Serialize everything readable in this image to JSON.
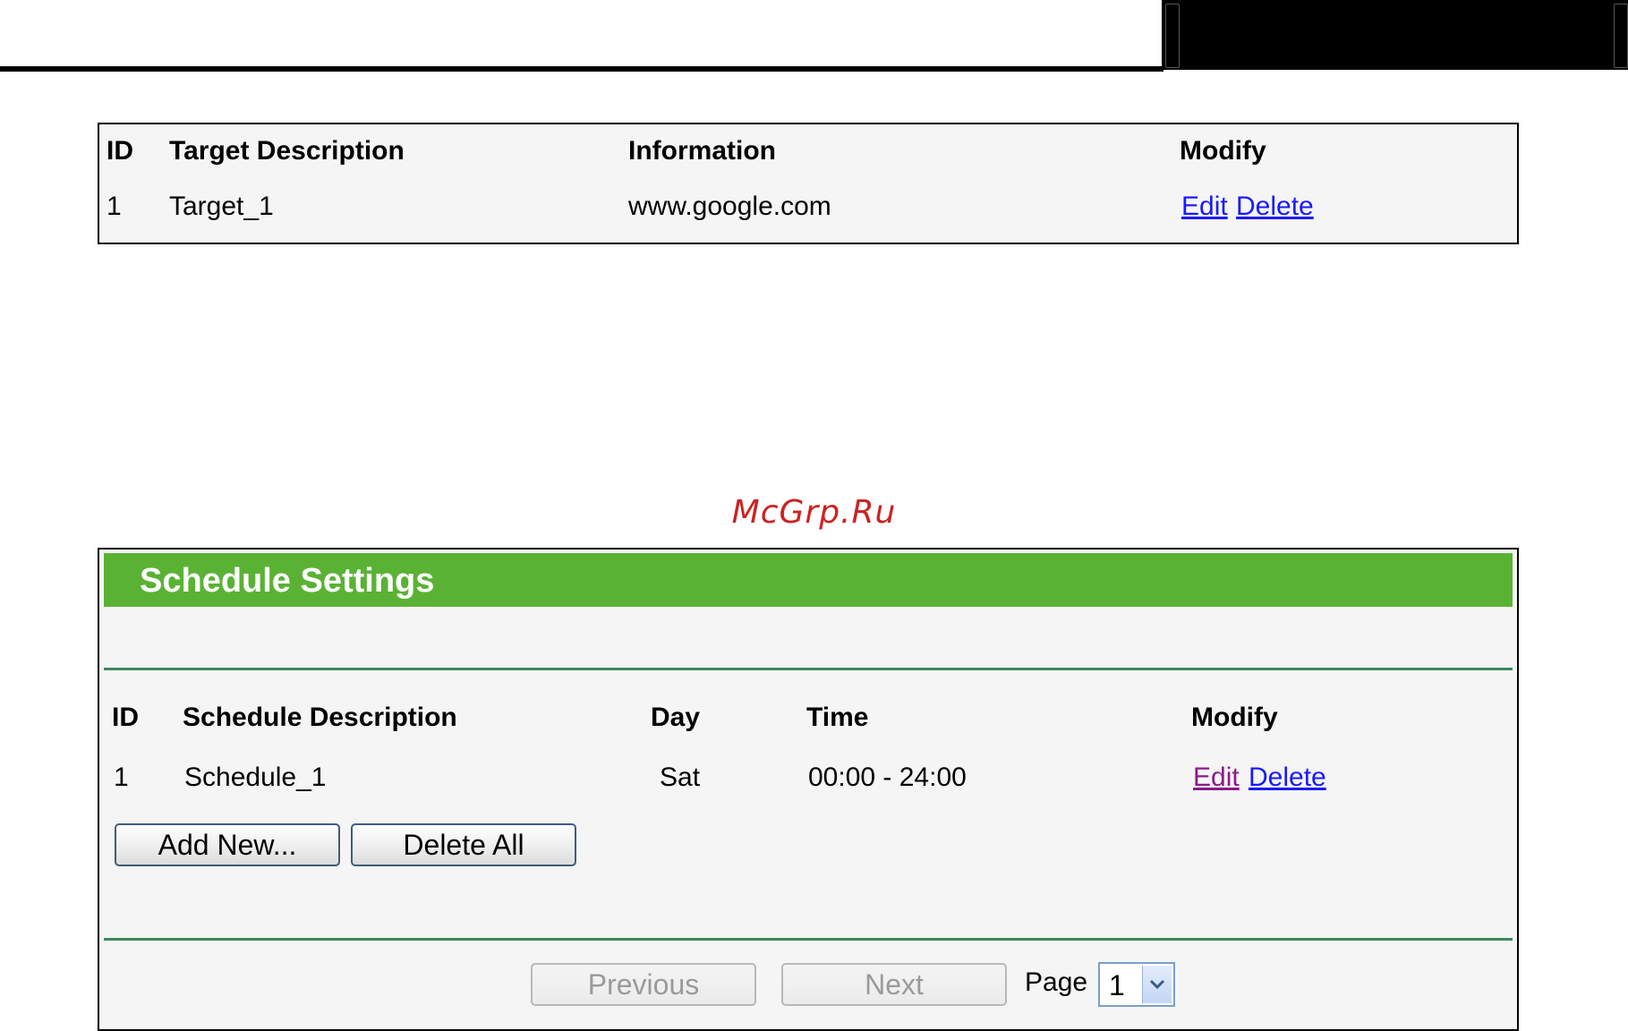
{
  "targets": {
    "headers": {
      "id": "ID",
      "description": "Target Description",
      "information": "Information",
      "modify": "Modify"
    },
    "rows": [
      {
        "id": "1",
        "description": "Target_1",
        "information": "www.google.com",
        "edit": "Edit",
        "delete": "Delete"
      }
    ]
  },
  "watermark": "McGrp.Ru",
  "schedule": {
    "title": "Schedule Settings",
    "headers": {
      "id": "ID",
      "description": "Schedule Description",
      "day": "Day",
      "time": "Time",
      "modify": "Modify"
    },
    "rows": [
      {
        "id": "1",
        "description": "Schedule_1",
        "day": "Sat",
        "time": "00:00 - 24:00",
        "edit": "Edit",
        "delete": "Delete"
      }
    ],
    "add_new_label": "Add New...",
    "delete_all_label": "Delete All",
    "previous_label": "Previous",
    "next_label": "Next",
    "page_label": "Page",
    "page_value": "1"
  },
  "colors": {
    "header_green": "#5ab234",
    "divider_green": "#3b8a5a",
    "link": "#1a1aff",
    "visited_link": "#8b1a8b"
  }
}
